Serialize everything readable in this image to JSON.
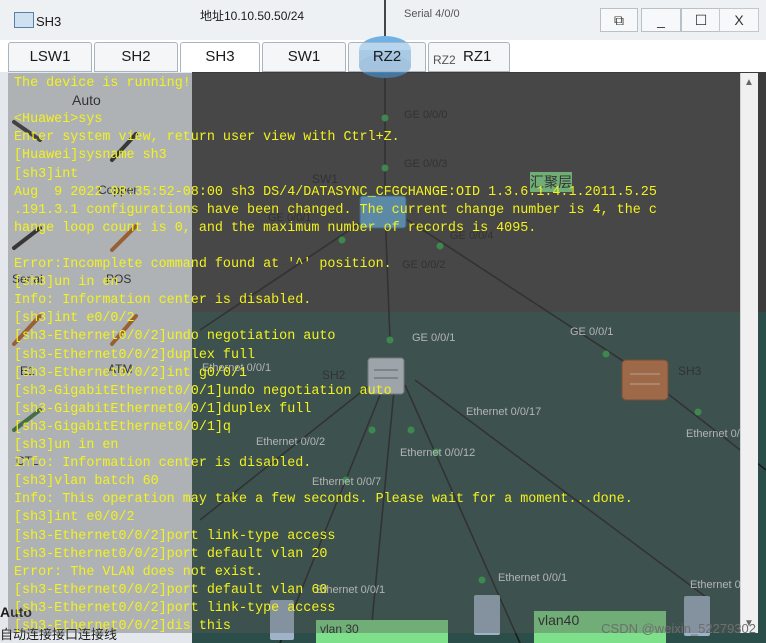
{
  "window": {
    "title": "SH3",
    "minimize": "_",
    "maximize": "☐",
    "close": "X"
  },
  "tabs": [
    {
      "label": "LSW1"
    },
    {
      "label": "SH2"
    },
    {
      "label": "SH3",
      "active": true
    },
    {
      "label": "SW1"
    },
    {
      "label": "RZ2"
    },
    {
      "label": "RZ1",
      "prefix": "RZ2"
    }
  ],
  "terminal_lines": [
    "The device is running!",
    "",
    "<Huawei>sys",
    "Enter system view, return user view with Ctrl+Z.",
    "[Huawei]sysname sh3",
    "[sh3]int",
    "Aug  9 2022 08:35:52-08:00 sh3 DS/4/DATASYNC_CFGCHANGE:OID 1.3.6.1.4.1.2011.5.25",
    ".191.3.1 configurations have been changed. The current change number is 4, the c",
    "hange loop count is 0, and the maximum number of records is 4095.",
    "",
    "Error:Incomplete command found at '^' position.",
    "[sh3]un in en",
    "Info: Information center is disabled.",
    "[sh3]int e0/0/2",
    "[sh3-Ethernet0/0/2]undo negotiation auto",
    "[sh3-Ethernet0/0/2]duplex full",
    "[sh3-Ethernet0/0/2]int g0/0/1",
    "[sh3-GigabitEthernet0/0/1]undo negotiation auto",
    "[sh3-GigabitEthernet0/0/1]duplex full",
    "[sh3-GigabitEthernet0/0/1]q",
    "[sh3]un in en",
    "Info: Information center is disabled.",
    "[sh3]vlan batch 60",
    "Info: This operation may take a few seconds. Please wait for a moment...done.",
    "[sh3]int e0/0/2",
    "[sh3-Ethernet0/0/2]port link-type access",
    "[sh3-Ethernet0/0/2]port default vlan 20",
    "Error: The VLAN does not exist.",
    "[sh3-Ethernet0/0/2]port default vlan 60",
    "[sh3-Ethernet0/0/2]port link-type access",
    "[sh3-Ethernet0/0/2]dis this"
  ],
  "topology": {
    "ip_label": "地址10.10.50.50/24",
    "serial_label": "Serial 4/0/0",
    "aggregation_label": "汇聚层",
    "node_labels": [
      "SW1",
      "SH2",
      "SH3"
    ],
    "port_labels": [
      "GE 0/0/0",
      "GE 0/0/3",
      "GE 0/0/1",
      "GE 0/0/4",
      "GE 0/0/2",
      "GE 0/0/1",
      "GE 0/0/1",
      "Ethernet 0/0/17",
      "Ethernet 0/0/2",
      "Ethernet 0/0/12",
      "Ethernet 0/0/7",
      "Ethernet 0/0/1",
      "Ethernet 0/0/1",
      "Ethernet 0/0/1",
      "Ethernet 0/0/",
      "Ethernet 0/"
    ],
    "vlan_labels": [
      "vlan 30",
      "vlan40"
    ]
  },
  "palette": {
    "items": [
      "Auto",
      "Copper",
      "Serial",
      "POS",
      "E1",
      "ATM",
      "CTL"
    ],
    "bottom_label": "Auto",
    "hint": "自动连接接口连接线"
  },
  "watermark": "CSDN @weixin_52279302"
}
